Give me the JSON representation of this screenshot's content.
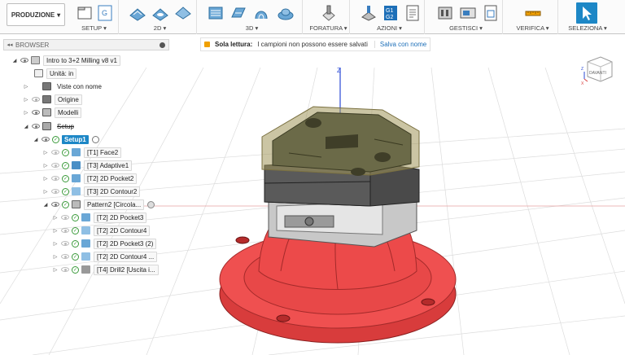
{
  "toolbar": {
    "workspace": "PRODUZIONE",
    "groups": [
      {
        "label": "SETUP ▾"
      },
      {
        "label": "2D ▾"
      },
      {
        "label": "3D ▾"
      },
      {
        "label": "FORATURA ▾"
      },
      {
        "label": "AZIONI ▾"
      },
      {
        "label": "GESTISCI ▾"
      },
      {
        "label": "VERIFICA ▾"
      },
      {
        "label": "SELEZIONA ▾"
      }
    ],
    "g1": "G1",
    "g2": "G2",
    "setup_g": "G"
  },
  "browser": {
    "title": "BROWSER",
    "nodes": [
      {
        "label": "Intro to 3+2 Milling v8 v1"
      },
      {
        "label": "Unità: in"
      },
      {
        "label": "Viste con nome"
      },
      {
        "label": "Origine"
      },
      {
        "label": "Modelli"
      },
      {
        "label": "Setup"
      },
      {
        "label": "Setup1"
      },
      {
        "label": "[T1] Face2"
      },
      {
        "label": "[T3] Adaptive1"
      },
      {
        "label": "[T2] 2D Pocket2"
      },
      {
        "label": "[T3] 2D Contour2"
      },
      {
        "label": "Pattern2 [Circola..."
      },
      {
        "label": "[T2] 2D Pocket3"
      },
      {
        "label": "[T2] 2D Contour4"
      },
      {
        "label": "[T2] 2D Pocket3 (2)"
      },
      {
        "label": "[T2] 2D Contour4 ..."
      },
      {
        "label": "[T4] Drill2 [Uscita i..."
      }
    ]
  },
  "notice": {
    "title": "Sola lettura:",
    "message": "I campioni non possono essere salvati",
    "action": "Salva con nome"
  },
  "viewcube": {
    "face": "DAVANTI",
    "z": "Z",
    "x": "X"
  },
  "axes": {
    "z": "Z"
  }
}
